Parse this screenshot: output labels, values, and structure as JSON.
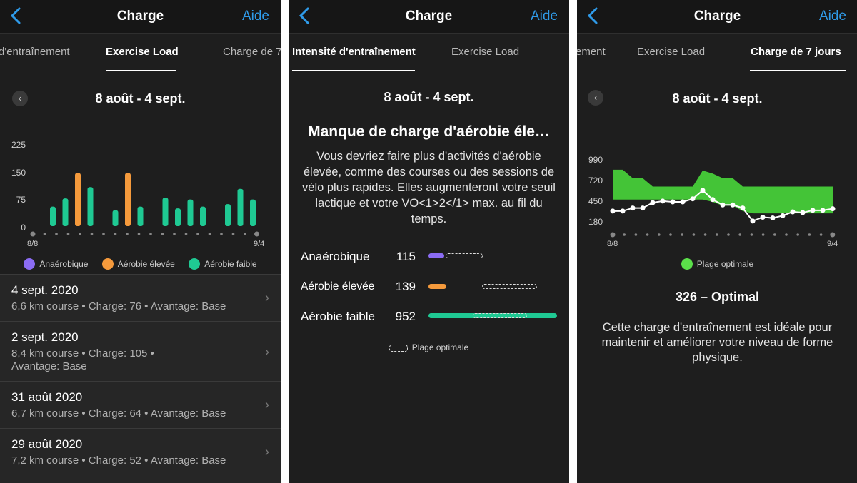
{
  "screen1": {
    "header": {
      "title": "Charge",
      "help": "Aide"
    },
    "tabs": [
      "d'entraînement",
      "Exercise Load",
      "Charge de 7"
    ],
    "date_range": "8 août - 4 sept.",
    "y_ticks": [
      "225",
      "150",
      "75",
      "0"
    ],
    "x_start": "8/8",
    "x_end": "9/4",
    "legend": [
      {
        "label": "Anaérobique",
        "color": "#8b6cf3"
      },
      {
        "label": "Aérobie élevée",
        "color": "#f59a3c"
      },
      {
        "label": "Aérobie faible",
        "color": "#1fc993"
      }
    ],
    "chart_data": {
      "type": "bar",
      "ylim": [
        0,
        225
      ],
      "y_ticks": [
        0,
        75,
        150,
        225
      ],
      "series": [
        {
          "name": "Aérobie faible",
          "values": [
            55,
            78,
            0,
            110,
            0,
            45,
            0,
            55,
            0,
            80,
            50,
            75,
            55,
            0,
            62,
            105,
            75
          ]
        },
        {
          "name": "Aérobie élevée",
          "values": [
            0,
            0,
            150,
            0,
            0,
            0,
            150,
            0,
            0,
            0,
            0,
            0,
            0,
            0,
            0,
            0,
            0
          ]
        },
        {
          "name": "Anaérobique",
          "values": [
            0,
            0,
            0,
            0,
            0,
            0,
            0,
            0,
            0,
            0,
            0,
            0,
            0,
            0,
            0,
            0,
            0
          ]
        }
      ]
    },
    "list": [
      {
        "date": "4 sept. 2020",
        "line1": "6,6 km course  •  Charge: 76  •  Avantage: Base",
        "line2": ""
      },
      {
        "date": "2 sept. 2020",
        "line1": "8,4 km course  •  Charge: 105  •",
        "line2": "Avantage: Base"
      },
      {
        "date": "31 août 2020",
        "line1": "6,7 km course  •  Charge: 64  •  Avantage: Base",
        "line2": ""
      },
      {
        "date": "29 août 2020",
        "line1": "7,2 km course  •  Charge: 52  •  Avantage: Base",
        "line2": ""
      }
    ]
  },
  "screen2": {
    "header": {
      "title": "Charge",
      "help": "Aide"
    },
    "tabs": [
      "Intensité d'entraînement",
      "Exercise Load"
    ],
    "date_range": "8 août - 4 sept.",
    "message_title": "Manque de charge d'aérobie éle…",
    "message_body": "Vous devriez faire plus d'activités d'aérobie élevée, comme des courses ou des sessions de vélo plus rapides. Elles augmenteront votre seuil lactique et votre VO<1>2</1> max. au fil du temps.",
    "rows": [
      {
        "label": "Anaérobique",
        "value": "115",
        "color": "#8b6cf3",
        "fill": 0.12
      },
      {
        "label": "Aérobie élevée",
        "value": "139",
        "color": "#f59a3c",
        "fill": 0.14
      },
      {
        "label": "Aérobie faible",
        "value": "952",
        "color": "#1fc993",
        "fill": 1.0
      }
    ],
    "optimal_label": "Plage optimale"
  },
  "screen3": {
    "header": {
      "title": "Charge",
      "help": "Aide"
    },
    "tabs": [
      "ement",
      "Exercise Load",
      "Charge de 7 jours"
    ],
    "date_range": "8 août - 4 sept.",
    "y_ticks": [
      "990",
      "720",
      "450",
      "180"
    ],
    "x_start": "8/8",
    "x_end": "9/4",
    "legend_label": "Plage optimale",
    "status": "326 – Optimal",
    "description": "Cette charge d'entraînement est idéale pour maintenir et améliorer votre niveau de forme physique.",
    "chart_data": {
      "type": "line",
      "ylim": [
        180,
        990
      ],
      "y_ticks": [
        180,
        450,
        720,
        990
      ],
      "series": [
        {
          "values": [
            330,
            330,
            370,
            370,
            440,
            460,
            450,
            450,
            490,
            600,
            480,
            410,
            410,
            370,
            200,
            250,
            240,
            270,
            320,
            310,
            340,
            340,
            360
          ]
        }
      ],
      "band_low": [
        480,
        480,
        480,
        480,
        480,
        480,
        480,
        480,
        480,
        480,
        450,
        400,
        400,
        330,
        300,
        300,
        300,
        300,
        300,
        300,
        300,
        300,
        300
      ],
      "band_high": [
        870,
        870,
        760,
        760,
        650,
        650,
        650,
        650,
        650,
        860,
        820,
        760,
        760,
        650,
        650,
        650,
        650,
        650,
        650,
        650,
        650,
        650,
        650
      ]
    }
  }
}
